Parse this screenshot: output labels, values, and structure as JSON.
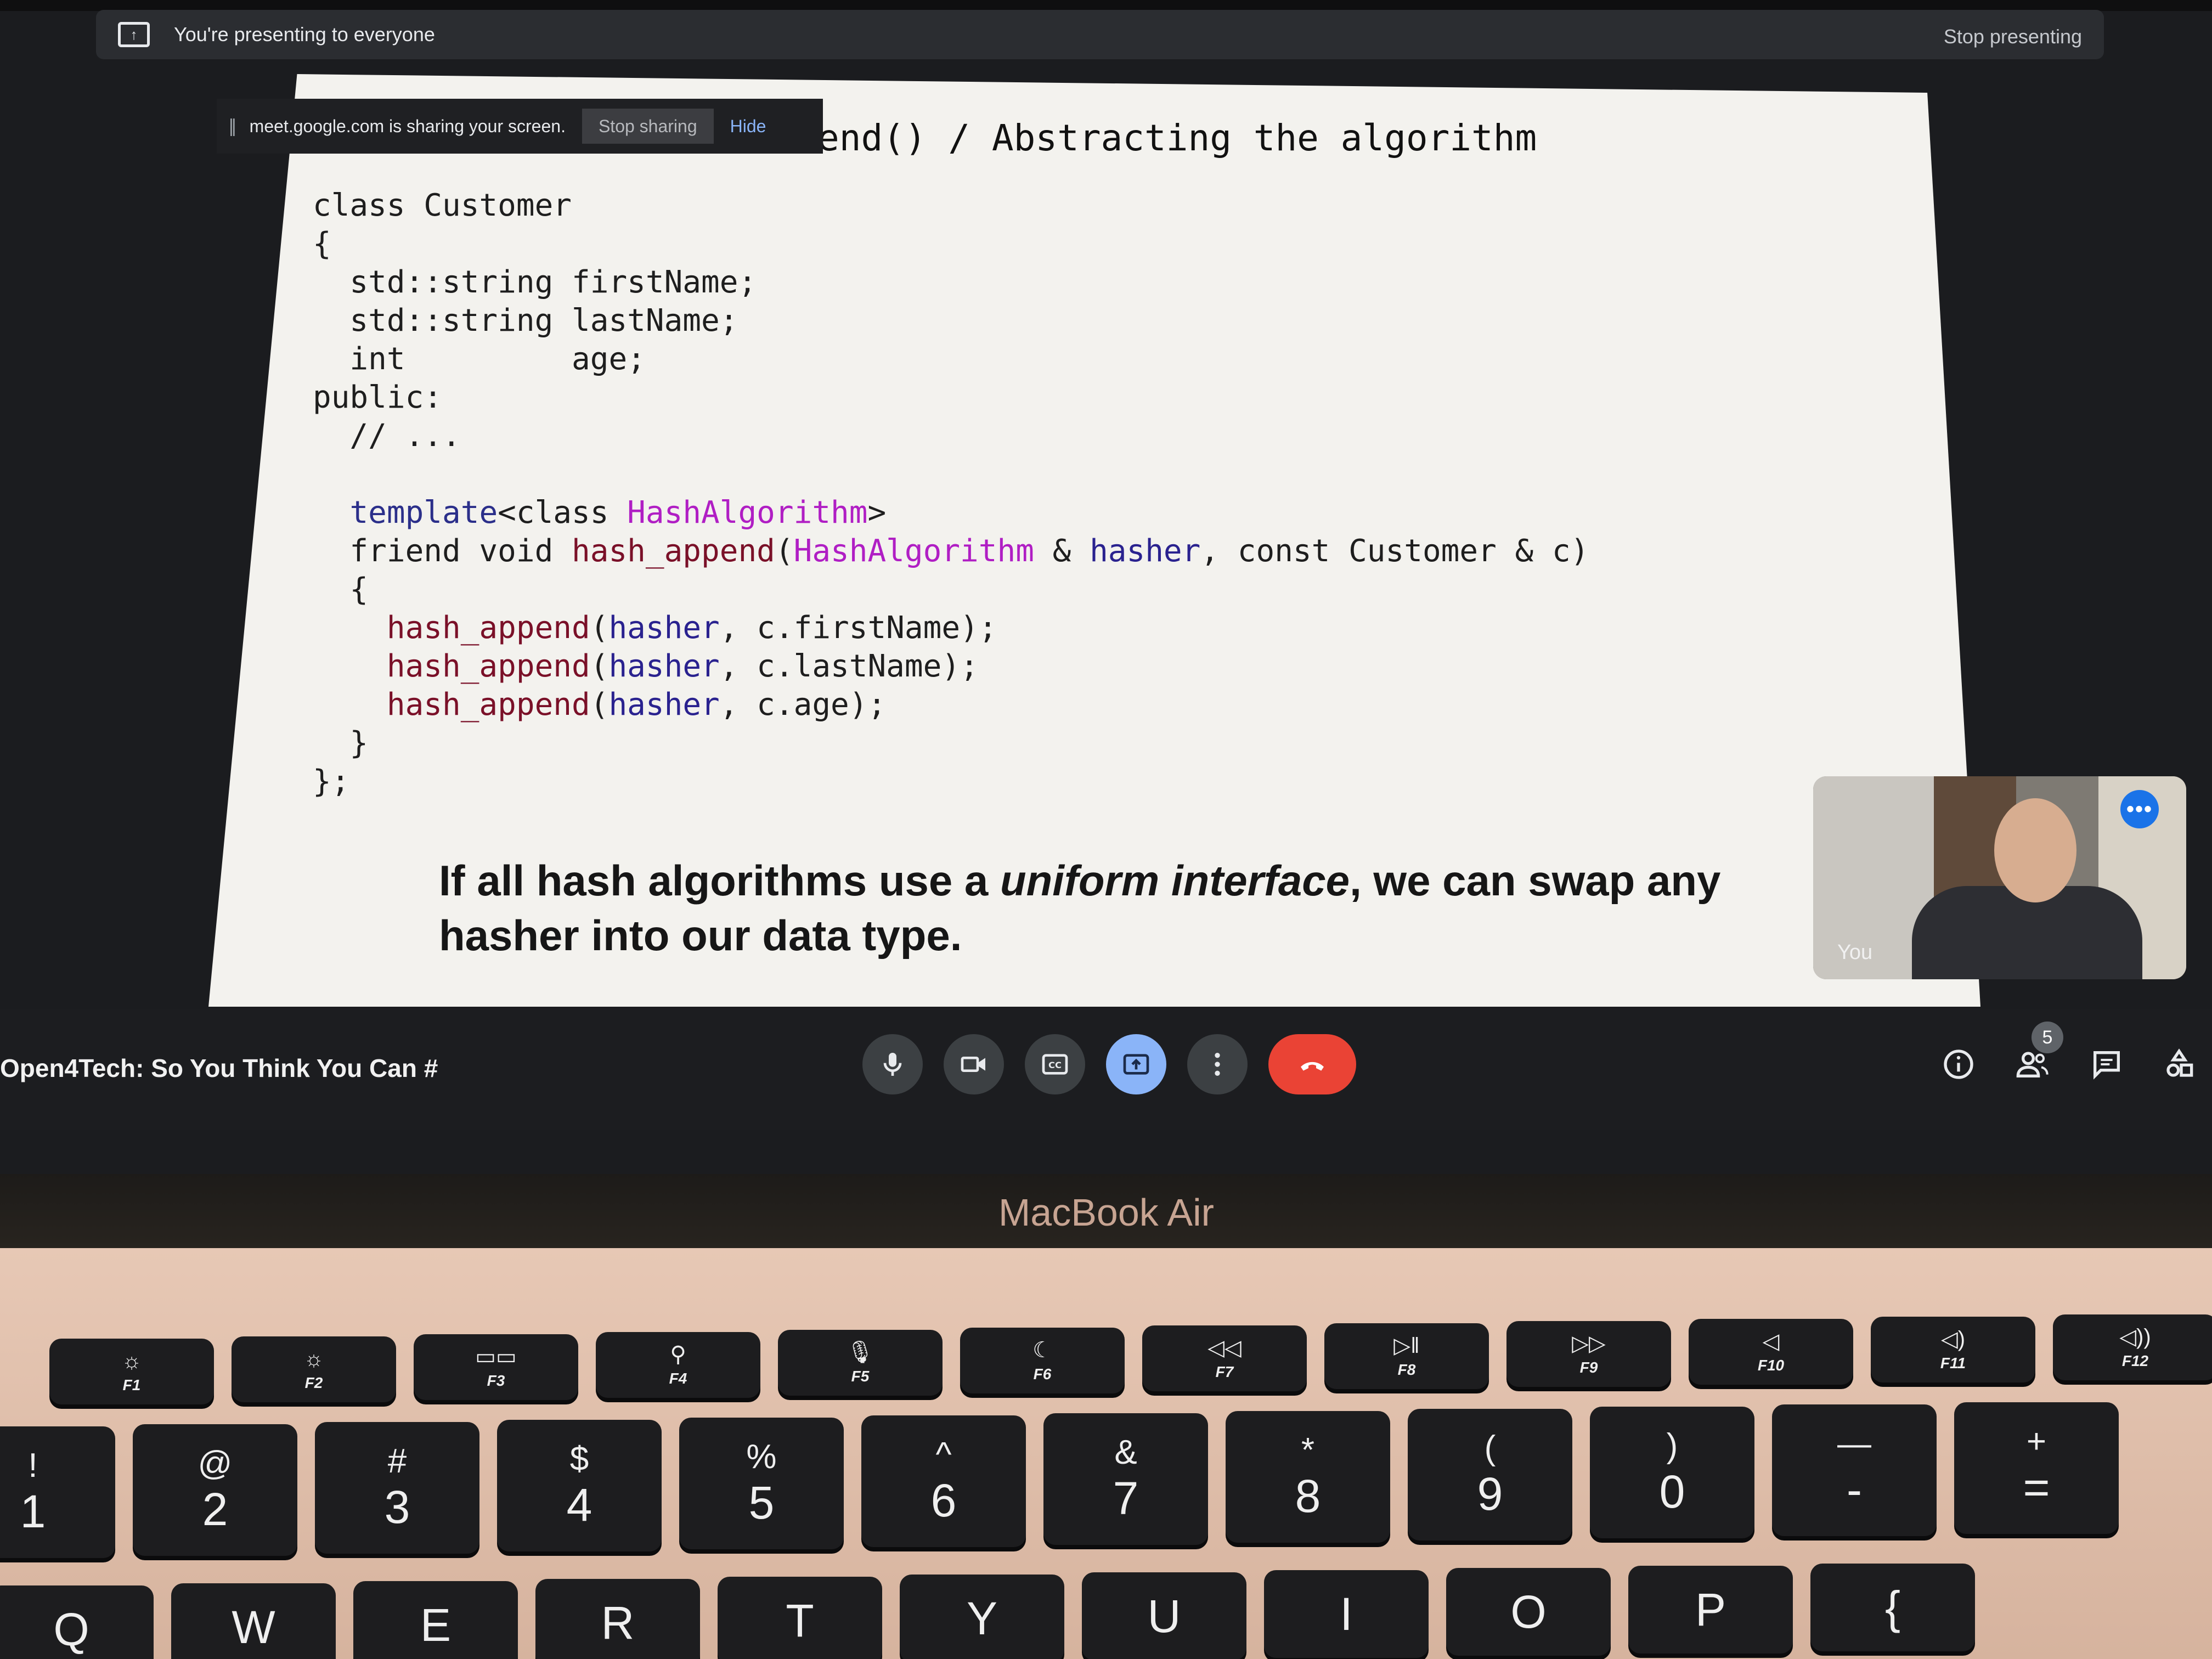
{
  "banner": {
    "text": "You're presenting to everyone",
    "stop_label": "Stop presenting"
  },
  "share_toast": {
    "handle": "||",
    "text": "meet.google.com is sharing your screen.",
    "stop_label": "Stop sharing",
    "hide_label": "Hide"
  },
  "slide": {
    "title": "end() / Abstracting the algorithm",
    "code_lines": [
      [
        {
          "t": "class Customer",
          "c": ""
        }
      ],
      [
        {
          "t": "{",
          "c": ""
        }
      ],
      [
        {
          "t": "  std::string firstName;",
          "c": ""
        }
      ],
      [
        {
          "t": "  std::string lastName;",
          "c": ""
        }
      ],
      [
        {
          "t": "  int         age;",
          "c": ""
        }
      ],
      [
        {
          "t": "public:",
          "c": ""
        }
      ],
      [
        {
          "t": "  // ...",
          "c": ""
        }
      ],
      [
        {
          "t": "",
          "c": ""
        }
      ],
      [
        {
          "t": "  ",
          "c": ""
        },
        {
          "t": "template",
          "c": "kw"
        },
        {
          "t": "<class ",
          "c": ""
        },
        {
          "t": "HashAlgorithm",
          "c": "ty"
        },
        {
          "t": ">",
          "c": ""
        }
      ],
      [
        {
          "t": "  friend void ",
          "c": ""
        },
        {
          "t": "hash_append",
          "c": "fn"
        },
        {
          "t": "(",
          "c": ""
        },
        {
          "t": "HashAlgorithm",
          "c": "ty"
        },
        {
          "t": " & ",
          "c": ""
        },
        {
          "t": "hasher",
          "c": "pr"
        },
        {
          "t": ", const Customer & c)",
          "c": ""
        }
      ],
      [
        {
          "t": "  {",
          "c": ""
        }
      ],
      [
        {
          "t": "    ",
          "c": ""
        },
        {
          "t": "hash_append",
          "c": "fn"
        },
        {
          "t": "(",
          "c": ""
        },
        {
          "t": "hasher",
          "c": "pr"
        },
        {
          "t": ", c.firstName);",
          "c": ""
        }
      ],
      [
        {
          "t": "    ",
          "c": ""
        },
        {
          "t": "hash_append",
          "c": "fn"
        },
        {
          "t": "(",
          "c": ""
        },
        {
          "t": "hasher",
          "c": "pr"
        },
        {
          "t": ", c.lastName);",
          "c": ""
        }
      ],
      [
        {
          "t": "    ",
          "c": ""
        },
        {
          "t": "hash_append",
          "c": "fn"
        },
        {
          "t": "(",
          "c": ""
        },
        {
          "t": "hasher",
          "c": "pr"
        },
        {
          "t": ", c.age);",
          "c": ""
        }
      ],
      [
        {
          "t": "  }",
          "c": ""
        }
      ],
      [
        {
          "t": "};",
          "c": ""
        }
      ]
    ],
    "caption_1": "If all hash algorithms use a ",
    "caption_em": "uniform interface",
    "caption_2": ", we can swap any hasher into our data type."
  },
  "self_view": {
    "label": "You",
    "menu_glyph": "•••"
  },
  "meeting": {
    "name": "Open4Tech: So You Think You Can #",
    "participant_count": "5"
  },
  "laptop": {
    "brand": "MacBook Air"
  },
  "keyboard": {
    "function_keys": [
      {
        "icon": "☼",
        "label": "F1"
      },
      {
        "icon": "☼",
        "label": "F2"
      },
      {
        "icon": "▭▭",
        "label": "F3"
      },
      {
        "icon": "⚲",
        "label": "F4"
      },
      {
        "icon": "🎙",
        "label": "F5"
      },
      {
        "icon": "☾",
        "label": "F6"
      },
      {
        "icon": "◁◁",
        "label": "F7"
      },
      {
        "icon": "▷ǁ",
        "label": "F8"
      },
      {
        "icon": "▷▷",
        "label": "F9"
      },
      {
        "icon": "◁",
        "label": "F10"
      },
      {
        "icon": "◁)",
        "label": "F11"
      },
      {
        "icon": "◁))",
        "label": "F12"
      }
    ],
    "number_keys": [
      {
        "top": "!",
        "bottom": "1"
      },
      {
        "top": "@",
        "bottom": "2"
      },
      {
        "top": "#",
        "bottom": "3"
      },
      {
        "top": "$",
        "bottom": "4"
      },
      {
        "top": "%",
        "bottom": "5"
      },
      {
        "top": "^",
        "bottom": "6"
      },
      {
        "top": "&",
        "bottom": "7"
      },
      {
        "top": "*",
        "bottom": "8"
      },
      {
        "top": "(",
        "bottom": "9"
      },
      {
        "top": ")",
        "bottom": "0"
      },
      {
        "top": "—",
        "bottom": "-"
      },
      {
        "top": "+",
        "bottom": "="
      }
    ],
    "letter_keys": [
      "Q",
      "W",
      "E",
      "R",
      "T",
      "Y",
      "U",
      "I",
      "O",
      "P",
      "{"
    ]
  },
  "colors": {
    "meet_blue": "#8ab4f8",
    "end_call_red": "#ea4335",
    "code_keyword": "#2b2f8a",
    "code_type": "#b01ec4",
    "code_function": "#7a1028"
  }
}
